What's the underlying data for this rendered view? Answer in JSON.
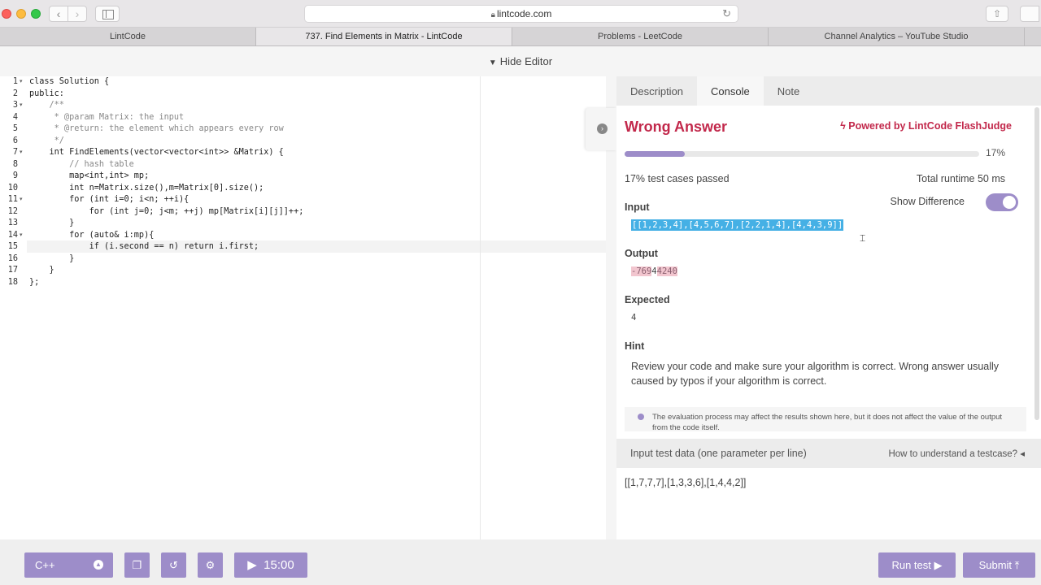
{
  "browser": {
    "url": "lintcode.com",
    "tabs": [
      "LintCode",
      "737. Find Elements in Matrix - LintCode",
      "Problems - LeetCode",
      "Channel Analytics – YouTube Studio"
    ]
  },
  "editor_toggle": {
    "label": "Hide Editor"
  },
  "code": {
    "lines": [
      "class Solution {",
      "public:",
      "    /**",
      "     * @param Matrix: the input",
      "     * @return: the element which appears every row",
      "     */",
      "    int FindElements(vector<vector<int>> &Matrix) {",
      "        // hash table",
      "        map<int,int> mp;",
      "        int n=Matrix.size(),m=Matrix[0].size();",
      "        for (int i=0; i<n; ++i){",
      "            for (int j=0; j<m; ++j) mp[Matrix[i][j]]++;",
      "        }",
      "        for (auto& i:mp){",
      "            if (i.second == n) return i.first;",
      "        }",
      "    }",
      "};"
    ],
    "line_numbers": [
      "1",
      "2",
      "3",
      "4",
      "5",
      "6",
      "7",
      "8",
      "9",
      "10",
      "11",
      "12",
      "13",
      "14",
      "15",
      "16",
      "17",
      "18"
    ],
    "active_line": "15"
  },
  "panel": {
    "tabs": [
      "Description",
      "Console",
      "Note"
    ],
    "active_tab": "Console",
    "verdict": "Wrong Answer",
    "powered_by": "Powered by LintCode FlashJudge",
    "progress_fraction": 0.17,
    "progress_label": "17%",
    "passed_text": "17% test cases passed",
    "runtime_text": "Total runtime 50 ms",
    "show_difference_label": "Show Difference",
    "show_difference_on": true,
    "input_label": "Input",
    "input_value": "[[1,2,3,4],[4,5,6,7],[2,2,1,4],[4,4,3,9]]",
    "output_label": "Output",
    "output_value_diff": "-769",
    "output_value_mid": "4",
    "output_value_tail": "4240",
    "expected_label": "Expected",
    "expected_value": "4",
    "hint_label": "Hint",
    "hint_text": "Review your code and make sure your algorithm is correct. Wrong answer usually caused by typos if your algorithm is correct.",
    "note_text": "The evaluation process may affect the results shown here, but it does not affect the value of the output from the code itself."
  },
  "test_data": {
    "title": "Input test data (one parameter per line)",
    "help": "How to understand a testcase?",
    "value": "[[1,7,7,7],[1,3,3,6],[1,4,4,2]]"
  },
  "toolbar": {
    "language": "C++",
    "timer": "15:00",
    "run_label": "Run test",
    "submit_label": "Submit",
    "accent_color": "#9d8dc9"
  },
  "colors": {
    "verdict": "#c2284b",
    "selection": "#45b0e5"
  }
}
